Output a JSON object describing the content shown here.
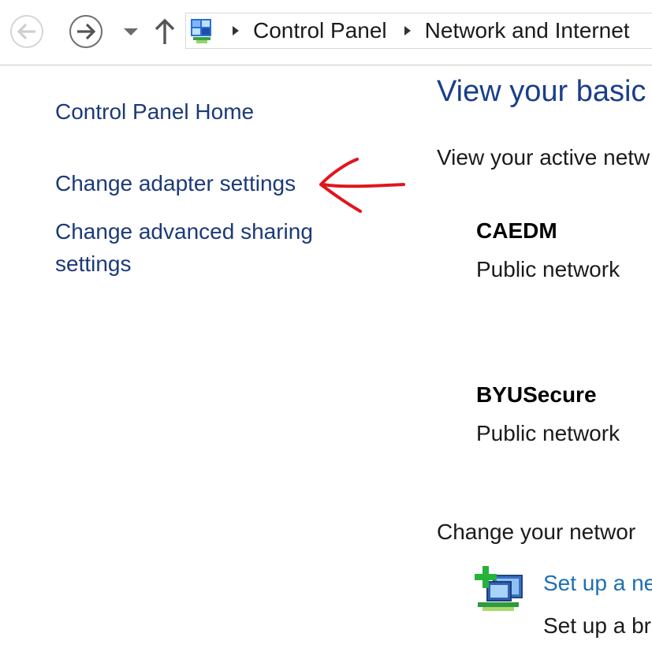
{
  "nav": {
    "back_icon": "back-arrow-icon",
    "forward_icon": "forward-arrow-icon",
    "recent_icon": "dropdown-triangle-icon",
    "up_icon": "up-arrow-icon"
  },
  "address_bar": {
    "icon": "control-panel-icon",
    "crumbs": [
      "Control Panel",
      "Network and Internet"
    ]
  },
  "left_pane": {
    "home": "Control Panel Home",
    "adapter": "Change adapter settings",
    "advanced": "Change advanced sharing settings"
  },
  "annotation": {
    "color": "#e0161c",
    "icon": "red-arrow-annotation"
  },
  "main": {
    "title": "View your basic",
    "active_networks_heading": "View your active netw",
    "networks": [
      {
        "name": "CAEDM",
        "type": "Public network"
      },
      {
        "name": "BYUSecure",
        "type": "Public network"
      }
    ],
    "change_heading": "Change your networ",
    "setup": {
      "icon": "network-setup-icon",
      "link": "Set up a ne",
      "description": "Set up a br"
    }
  },
  "colors": {
    "link_dark": "#1c3a78",
    "title": "#1a3e8c",
    "link_blue": "#1f6fb4"
  }
}
